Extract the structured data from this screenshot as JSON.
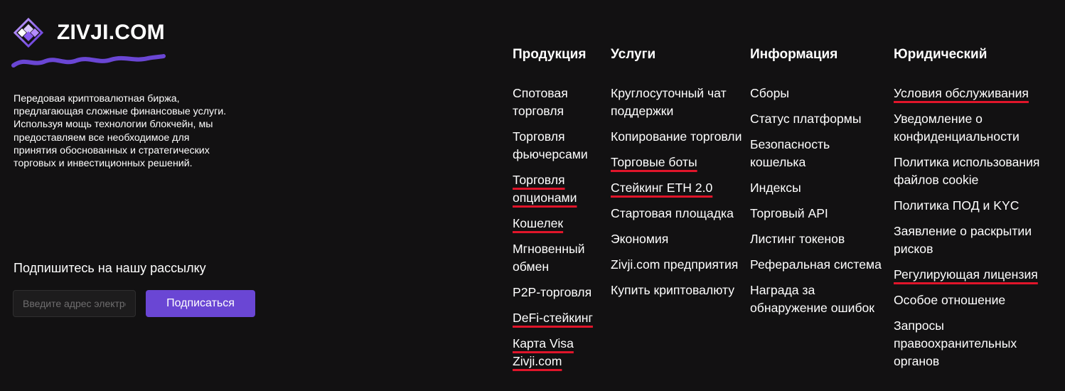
{
  "brand": {
    "name": "ZIVJI.COM",
    "tagline": "Передовая криптовалютная биржа, предлагающая сложные финансовые услуги. Используя мощь технологии блокчейн, мы предоставляем все необходимое для принятия обоснованных и стратегических торговых и инвестиционных решений."
  },
  "newsletter": {
    "heading": "Подпишитесь на нашу рассылку",
    "placeholder": "Введите адрес электронной почты",
    "value": "",
    "button_label": "Подписаться"
  },
  "colors": {
    "background": "#121112",
    "accent": "#6a46d4",
    "highlight_underline": "#e0152a"
  },
  "columns": {
    "products": {
      "heading": "Продукция",
      "items": [
        {
          "label": "Спотовая торговля"
        },
        {
          "label": "Торговля фьючерсами"
        },
        {
          "label": "Торговля опционами"
        },
        {
          "label": "Кошелек"
        },
        {
          "label": "Мгновенный обмен"
        },
        {
          "label": "P2P-торговля"
        },
        {
          "label": "DeFi-стейкинг"
        },
        {
          "label": "Карта Visa Zivji.com"
        }
      ]
    },
    "services": {
      "heading": "Услуги",
      "items": [
        {
          "label": "Круглосуточный чат поддержки"
        },
        {
          "label": "Копирование торговли"
        },
        {
          "label": "Торговые боты"
        },
        {
          "label": "Стейкинг ETH 2.0"
        },
        {
          "label": "Стартовая площадка"
        },
        {
          "label": "Экономия"
        },
        {
          "label": "Zivji.com предприятия"
        },
        {
          "label": "Купить криптовалюту"
        }
      ]
    },
    "info": {
      "heading": "Информация",
      "items": [
        {
          "label": "Сборы"
        },
        {
          "label": "Статус платформы"
        },
        {
          "label": "Безопасность кошелька"
        },
        {
          "label": "Индексы"
        },
        {
          "label": "Торговый API"
        },
        {
          "label": "Листинг токенов"
        },
        {
          "label": "Реферальная система"
        },
        {
          "label": "Награда за обнаружение ошибок"
        }
      ]
    },
    "legal": {
      "heading": "Юридический",
      "items": [
        {
          "label": "Условия обслуживания"
        },
        {
          "label": "Уведомление о конфиденциальности"
        },
        {
          "label": "Политика использования файлов cookie"
        },
        {
          "label": "Политика ПОД и KYC"
        },
        {
          "label": "Заявление о раскрытии рисков"
        },
        {
          "label": "Регулирующая лицензия"
        },
        {
          "label": "Особое отношение"
        },
        {
          "label": "Запросы правоохранительных органов"
        }
      ]
    }
  }
}
